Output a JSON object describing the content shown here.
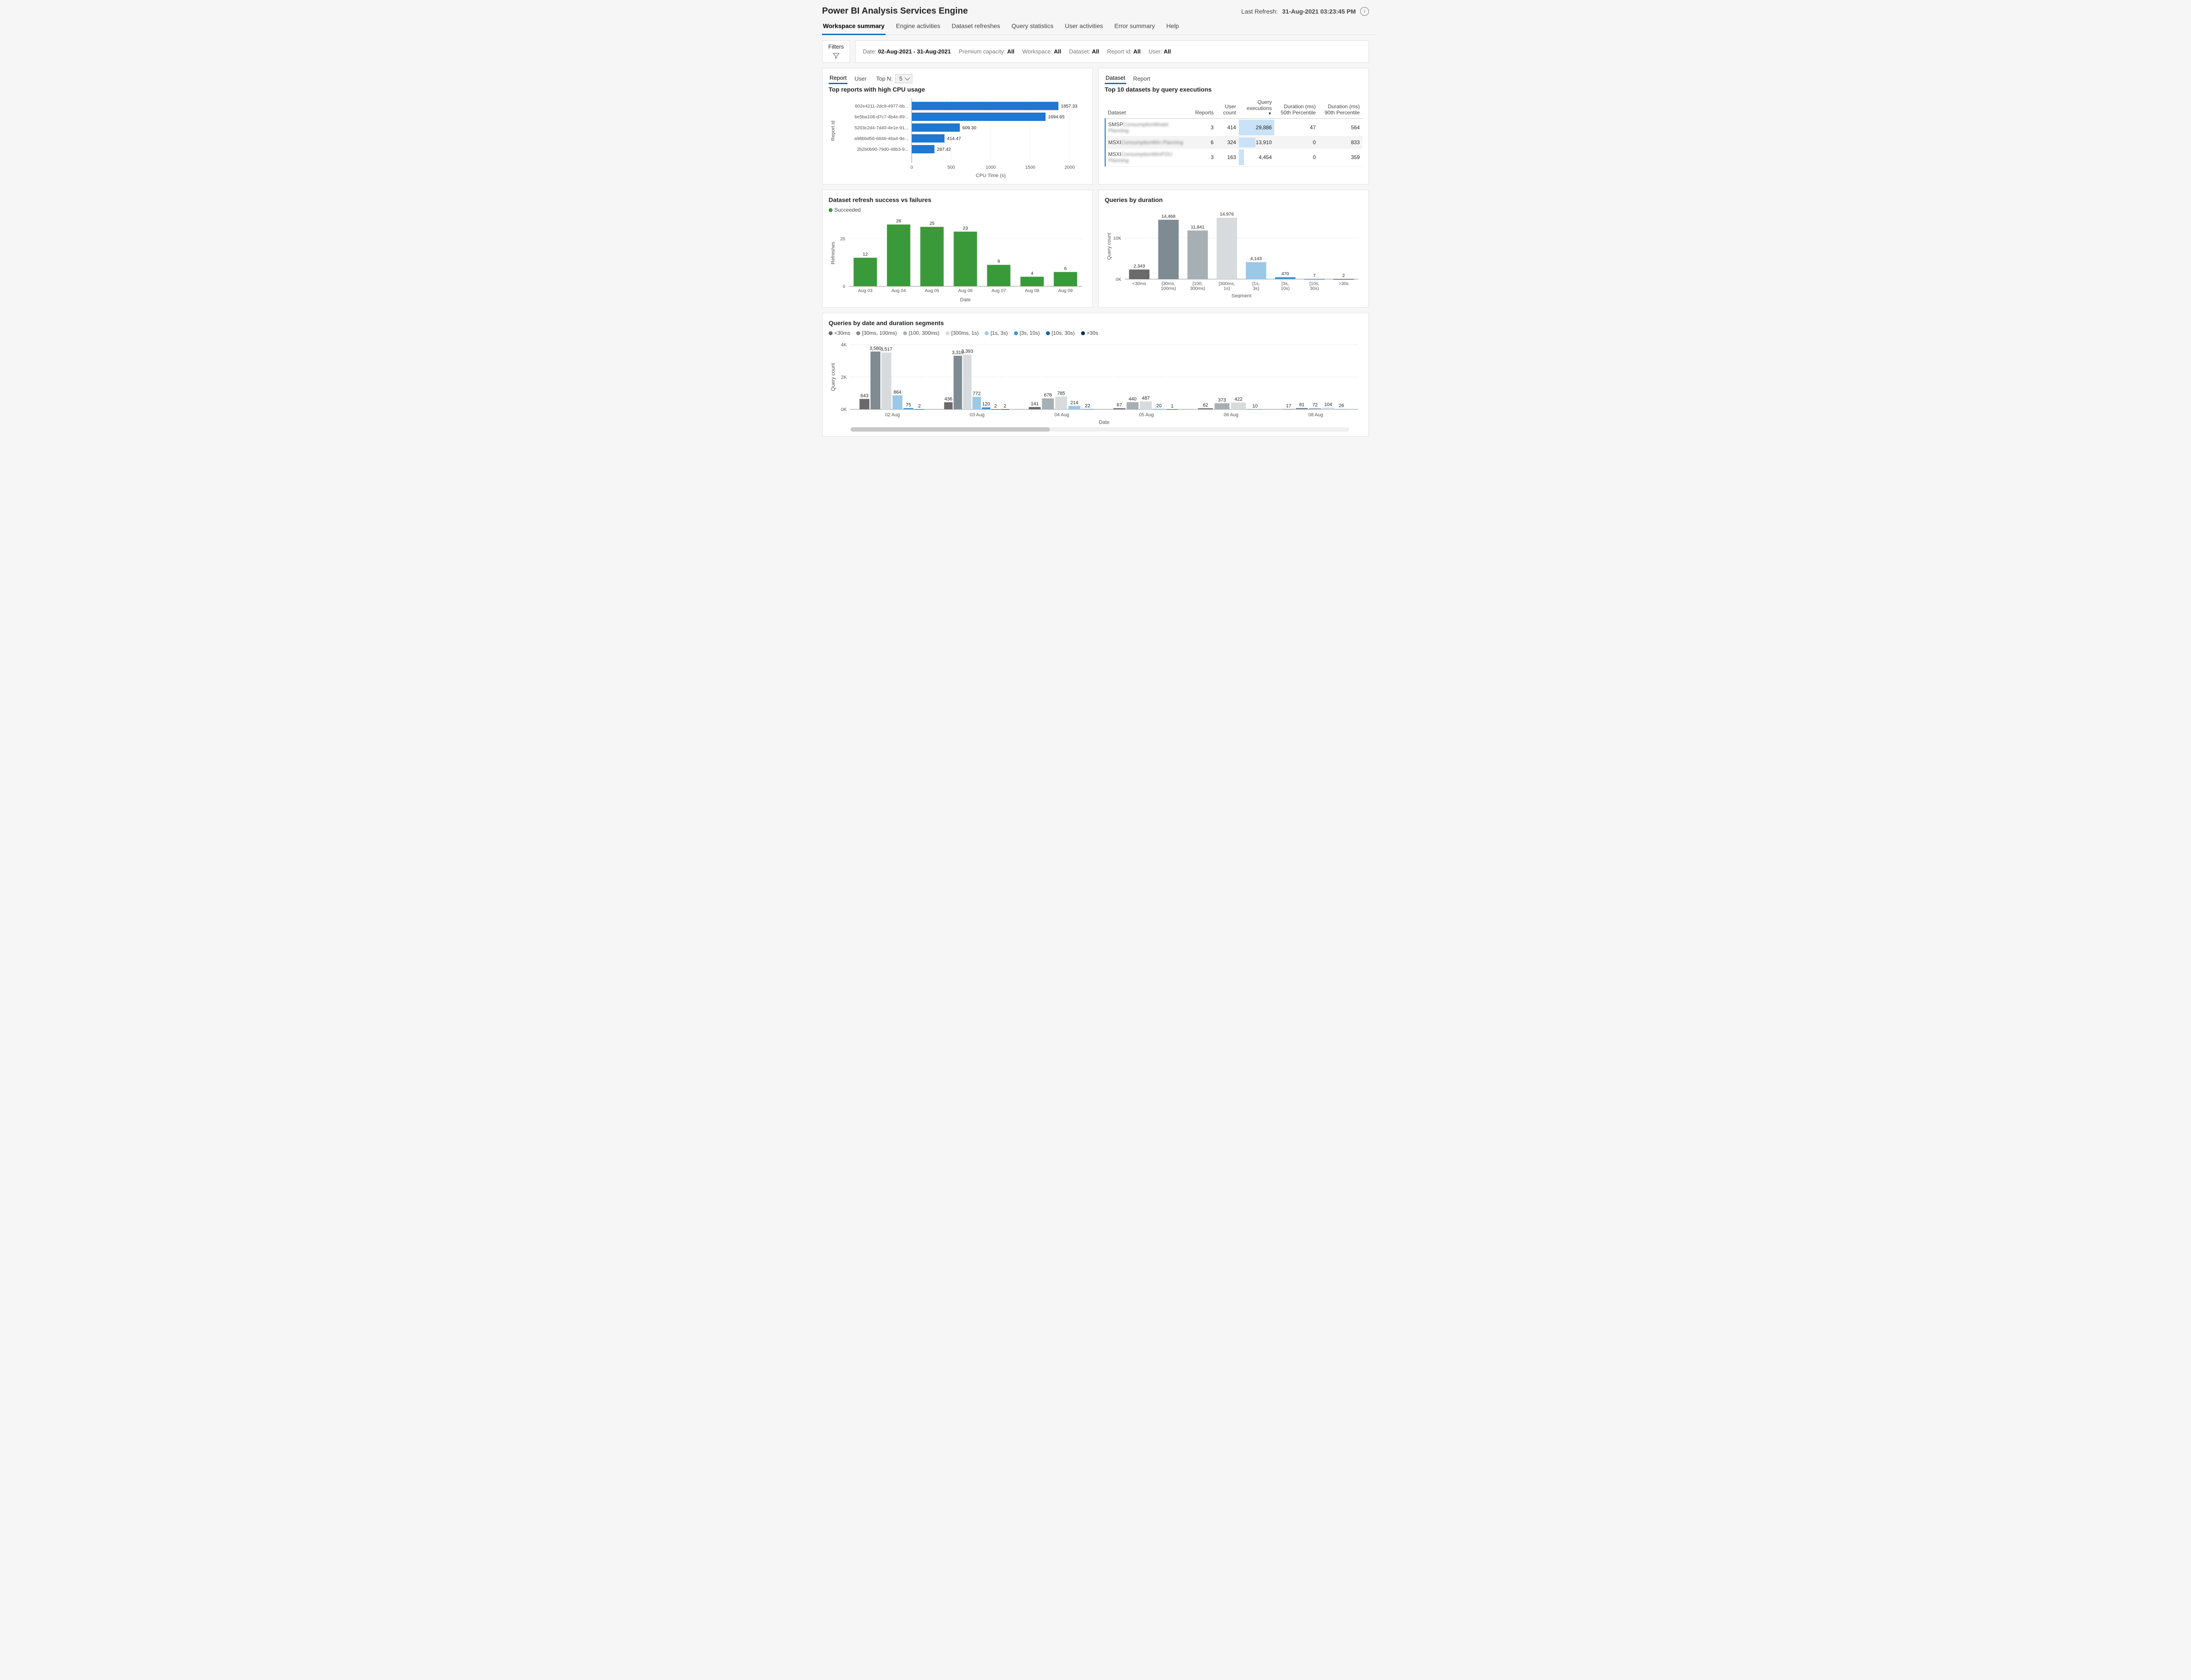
{
  "header": {
    "title": "Power BI Analysis Services Engine",
    "last_refresh_label": "Last Refresh:",
    "last_refresh_value": "31-Aug-2021 03:23:45 PM"
  },
  "tabs": [
    "Workspace summary",
    "Engine activities",
    "Dataset refreshes",
    "Query statistics",
    "User activities",
    "Error summary",
    "Help"
  ],
  "active_tab": 0,
  "filters": {
    "button_label": "Filters",
    "items": [
      {
        "label": "Date:",
        "value": "02-Aug-2021 - 31-Aug-2021"
      },
      {
        "label": "Premium capacity:",
        "value": "All"
      },
      {
        "label": "Workspace:",
        "value": "All"
      },
      {
        "label": "Dataset:",
        "value": "All"
      },
      {
        "label": "Report id:",
        "value": "All"
      },
      {
        "label": "User:",
        "value": "All"
      }
    ]
  },
  "top_reports_panel": {
    "subtabs": [
      "Report",
      "User"
    ],
    "active_subtab": 0,
    "topn_label": "Top N:",
    "topn_value": "5",
    "title": "Top reports with high CPU usage",
    "xaxis": "CPU Time (s)",
    "yaxis": "Report id"
  },
  "top_datasets_panel": {
    "subtabs": [
      "Dataset",
      "Report"
    ],
    "active_subtab": 0,
    "title": "Top 10 datasets by query executions",
    "columns": [
      "Dataset",
      "Reports",
      "User count",
      "Query executions",
      "Duration (ms) 50th Percentile",
      "Duration (ms) 90th Percentile"
    ]
  },
  "refresh_panel": {
    "title": "Dataset refresh success vs failures",
    "legend": [
      "Succeeded"
    ],
    "yaxis": "Refreshes",
    "xaxis": "Date"
  },
  "queries_duration_panel": {
    "title": "Queries by duration",
    "yaxis": "Query count",
    "xaxis": "Segment"
  },
  "queries_by_date_panel": {
    "title": "Queries by date and duration segments",
    "legend": [
      "<30ms",
      "[30ms, 100ms)",
      "[100, 300ms)",
      "[300ms, 1s)",
      "[1s, 3s)",
      "[3s, 10s)",
      "[10s, 30s)",
      ">30s"
    ],
    "yaxis": "Query count",
    "xaxis": "Date"
  },
  "chart_data": [
    {
      "id": "top_reports",
      "type": "bar",
      "orientation": "horizontal",
      "categories": [
        "602e4211-2dc9-4977-bb...",
        "be5ba108-d7c7-4b4e-89...",
        "5203c2d4-7d40-4e1e-91...",
        "a98bbd56-6846-46a4-9e...",
        "2b2b0b90-79d0-48b3-9..."
      ],
      "values": [
        1857.33,
        1694.65,
        609.3,
        414.47,
        287.42
      ],
      "xlabel": "CPU Time (s)",
      "ylabel": "Report id",
      "xlim": [
        0,
        2000
      ],
      "xticks": [
        0,
        500,
        1000,
        1500,
        2000
      ],
      "color": "#1f77d0"
    },
    {
      "id": "top_datasets",
      "type": "table",
      "columns": [
        "Dataset",
        "Reports",
        "User count",
        "Query executions",
        "Duration (ms) 50th Percentile",
        "Duration (ms) 90th Percentile"
      ],
      "rows": [
        {
          "dataset_prefix": "SMSP",
          "dataset_blur": "ConsumptionModel Planning",
          "reports": 3,
          "user_count": 414,
          "query_executions": 29886,
          "p50": 47,
          "p90": 564
        },
        {
          "dataset_prefix": "MSXI",
          "dataset_blur": "ConsumptionWin Planning",
          "reports": 6,
          "user_count": 324,
          "query_executions": 13910,
          "p50": 0,
          "p90": 833
        },
        {
          "dataset_prefix": "MSXI",
          "dataset_blur": "ConsumptionWinFOU Planning",
          "reports": 3,
          "user_count": 163,
          "query_executions": 4454,
          "p50": 0,
          "p90": 359
        }
      ],
      "sort_column": "Query executions",
      "sort_dir": "desc"
    },
    {
      "id": "refresh_success",
      "type": "bar",
      "categories": [
        "Aug 03",
        "Aug 04",
        "Aug 05",
        "Aug 06",
        "Aug 07",
        "Aug 08",
        "Aug 09"
      ],
      "series": [
        {
          "name": "Succeeded",
          "values": [
            12,
            26,
            25,
            23,
            9,
            4,
            6
          ],
          "color": "#3a9a3a"
        }
      ],
      "ylabel": "Refreshes",
      "xlabel": "Date",
      "ylim": [
        0,
        28
      ],
      "yticks": [
        0,
        20
      ]
    },
    {
      "id": "queries_by_duration",
      "type": "bar",
      "categories": [
        "<30ms",
        "[30ms, 100ms)",
        "[100, 300ms)",
        "[300ms, 1s)",
        "[1s, 3s)",
        "[3s, 10s)",
        "[10s, 30s)",
        ">30s"
      ],
      "values": [
        2343,
        14468,
        11841,
        14976,
        4143,
        470,
        7,
        2
      ],
      "colors": [
        "#6a6a6a",
        "#7e8b92",
        "#a6afb4",
        "#d7dbdd",
        "#9cc8e8",
        "#3f94d1",
        "#1b5f9e",
        "#0a2f55"
      ],
      "ylabel": "Query count",
      "xlabel": "Segment",
      "ylim": [
        0,
        16000
      ],
      "yticks": [
        0,
        10000
      ],
      "ytick_labels": [
        "0K",
        "10K"
      ]
    },
    {
      "id": "queries_by_date_segment",
      "type": "bar",
      "grouped": true,
      "categories": [
        "02 Aug",
        "03 Aug",
        "04 Aug",
        "05 Aug",
        "06 Aug",
        "08 Aug"
      ],
      "segment_names": [
        "<30ms",
        "[30ms, 100ms)",
        "[100, 300ms)",
        "[300ms, 1s)",
        "[1s, 3s)",
        "[3s, 10s)",
        "[10s, 30s)",
        ">30s"
      ],
      "colors": [
        "#6a6a6a",
        "#7e8b92",
        "#a6afb4",
        "#d7dbdd",
        "#9cc8e8",
        "#3f94d1",
        "#1b5f9e",
        "#0a2f55"
      ],
      "series": [
        {
          "date": "02 Aug",
          "values": [
            643,
            3580,
            null,
            3517,
            864,
            75,
            2,
            null
          ],
          "labels": [
            "643",
            "3,580",
            "",
            "3,517",
            "864",
            "75",
            "2",
            ""
          ]
        },
        {
          "date": "03 Aug",
          "values": [
            436,
            3319,
            null,
            3393,
            772,
            120,
            2,
            2
          ],
          "labels": [
            "436",
            "3,319",
            "",
            "3,393",
            "772",
            "120",
            "2",
            "2"
          ]
        },
        {
          "date": "04 Aug",
          "values": [
            141,
            null,
            678,
            785,
            214,
            22,
            null,
            null
          ],
          "labels": [
            "141",
            "",
            "678",
            "785",
            "214",
            "22",
            "",
            ""
          ]
        },
        {
          "date": "05 Aug",
          "values": [
            67,
            null,
            440,
            487,
            null,
            20,
            1,
            null
          ],
          "labels": [
            "67",
            "",
            "440",
            "487",
            "",
            "20",
            "1",
            ""
          ]
        },
        {
          "date": "06 Aug",
          "values": [
            62,
            null,
            373,
            422,
            null,
            10,
            null,
            null
          ],
          "labels": [
            "62",
            "",
            "373",
            "422",
            "",
            "10",
            "",
            ""
          ]
        },
        {
          "date": "08 Aug",
          "values": [
            17,
            81,
            72,
            104,
            26,
            null,
            null,
            null
          ],
          "labels": [
            "17",
            "81",
            "72",
            "104",
            "26",
            "",
            "",
            ""
          ]
        }
      ],
      "ylabel": "Query count",
      "xlabel": "Date",
      "ylim": [
        0,
        4000
      ],
      "yticks": [
        0,
        2000,
        4000
      ],
      "ytick_labels": [
        "0K",
        "2K",
        "4K"
      ]
    }
  ]
}
